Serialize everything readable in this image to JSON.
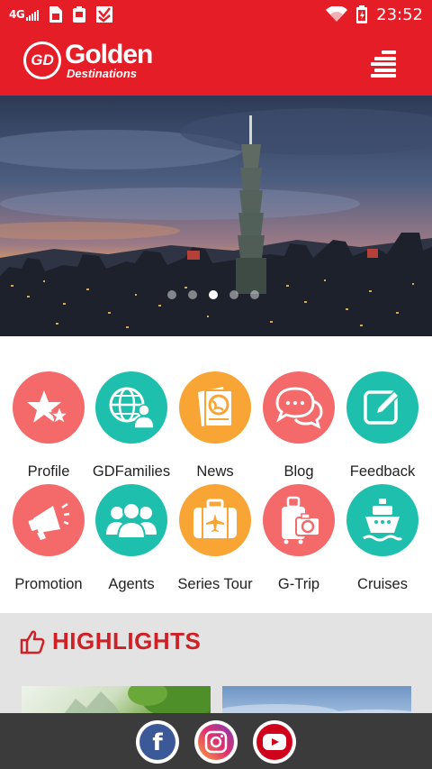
{
  "status_bar": {
    "network": "4G",
    "time": "23:52",
    "icons": [
      "signal-icon",
      "sim-card-icon",
      "battery-saver-icon",
      "download-check-icon",
      "wifi-icon",
      "battery-icon"
    ]
  },
  "header": {
    "logo_mark": "GD",
    "logo_title": "Golden",
    "logo_subtitle": "Destinations",
    "menu_icon": "hamburger-menu-icon"
  },
  "banner": {
    "image": "taipei-101-skyline-at-sunset",
    "slide_count": 5,
    "active_slide": 3
  },
  "menu": {
    "items": [
      {
        "label": "Profile",
        "icon": "star-icon",
        "color": "#f46a6a"
      },
      {
        "label": "GDFamilies",
        "icon": "globe-people-icon",
        "color": "#1fbfad"
      },
      {
        "label": "News",
        "icon": "news-globe-icon",
        "color": "#f9a535"
      },
      {
        "label": "Blog",
        "icon": "chat-bubbles-icon",
        "color": "#f46a6a"
      },
      {
        "label": "Feedback",
        "icon": "edit-icon",
        "color": "#1fbfad"
      },
      {
        "label": "Promotion",
        "icon": "megaphone-icon",
        "color": "#f46a6a"
      },
      {
        "label": "Agents",
        "icon": "people-group-icon",
        "color": "#1fbfad"
      },
      {
        "label": "Series Tour",
        "icon": "suitcase-plane-icon",
        "color": "#f9a535"
      },
      {
        "label": "G-Trip",
        "icon": "luggage-camera-icon",
        "color": "#f46a6a"
      },
      {
        "label": "Cruises",
        "icon": "ship-icon",
        "color": "#1fbfad"
      }
    ]
  },
  "highlights": {
    "title": "HIGHLIGHTS",
    "icon": "thumbs-up-icon",
    "accent": "#cf2026"
  },
  "social": {
    "items": [
      {
        "name": "facebook",
        "glyph": "f",
        "color": "#3b5998"
      },
      {
        "name": "instagram",
        "color": "#c13584"
      },
      {
        "name": "youtube",
        "color": "#d0021b"
      }
    ]
  },
  "colors": {
    "brand_red": "#e41d27",
    "coral": "#f46a6a",
    "teal": "#1fbfad",
    "orange": "#f9a535"
  }
}
